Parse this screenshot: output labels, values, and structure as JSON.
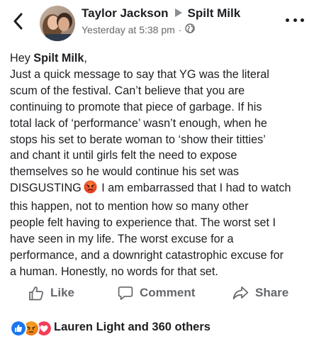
{
  "header": {
    "author": "Taylor Jackson",
    "target": "Spilt Milk",
    "timestamp": "Yesterday at 5:38 pm",
    "separator": "·",
    "privacy_icon": "globe-icon",
    "back_icon": "chevron-left-icon",
    "menu_icon": "more-horizontal-icon"
  },
  "post": {
    "greeting_prefix": "Hey ",
    "greeting_name": "Spilt Milk",
    "greeting_suffix": ",",
    "lines": [
      "Just a quick message to say that YG was the literal",
      "scum of the festival. Can’t believe that you are",
      "continuing to promote that piece of garbage. If his",
      "total lack of ‘performance’ wasn’t enough, when he",
      "stops his set to berate woman to ‘show their titties’",
      "and chant it until girls felt the need to expose",
      "themselves so he would continue his set was"
    ],
    "line_with_emoji_before": "DISGUSTING",
    "line_with_emoji_after": " I am embarrassed that I had to watch",
    "emoji": "angry-face-emoji",
    "lines_after": [
      "this happen, not to mention how so many other",
      "people felt having to experience that. The worst set I",
      "have seen in my life. The worst excuse for a",
      "performance, and a downright catastrophic excuse for",
      "a human. Honestly, no words for that set."
    ]
  },
  "actions": {
    "like_label": "Like",
    "comment_label": "Comment",
    "share_label": "Share"
  },
  "reactions": {
    "summary": "Lauren Light and 360 others",
    "icons": [
      "like-reaction-icon",
      "angry-reaction-icon",
      "love-reaction-icon"
    ]
  },
  "colors": {
    "text": "#1c1e21",
    "secondary": "#65676b",
    "like_blue": "#1877f2",
    "love_red": "#f33e58",
    "angry_orange": "#e9710f"
  }
}
